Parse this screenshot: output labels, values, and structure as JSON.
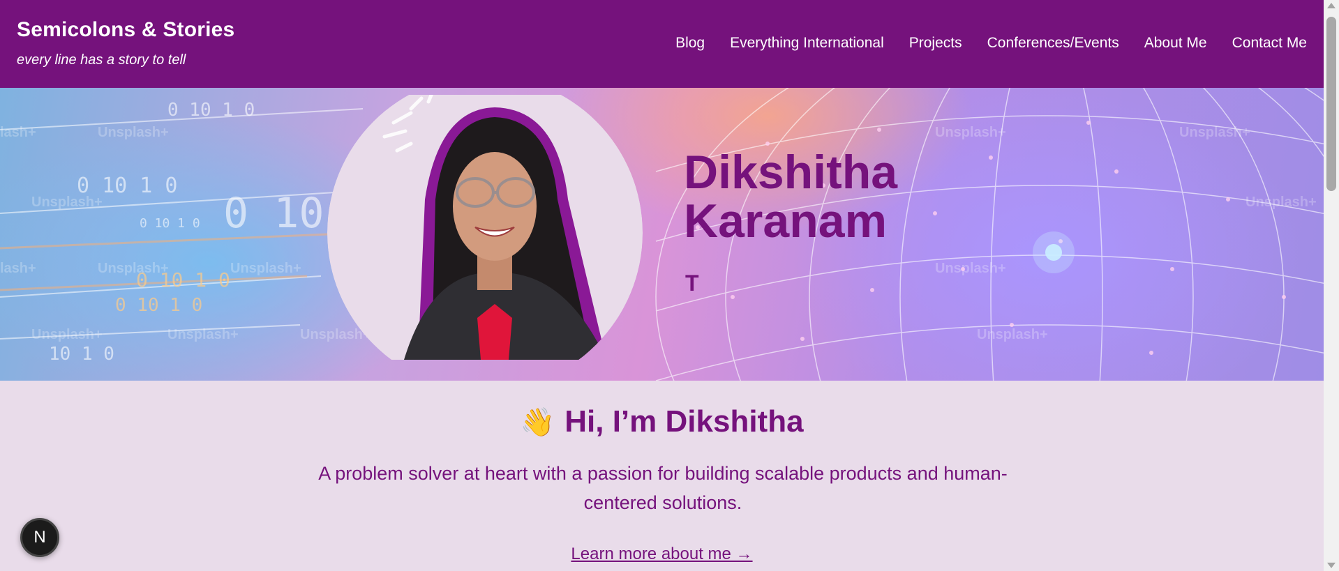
{
  "header": {
    "title": "Semicolons & Stories",
    "tagline": "every line has a story to tell",
    "nav": [
      "Blog",
      "Everything International",
      "Projects",
      "Conferences/Events",
      "About Me",
      "Contact Me"
    ],
    "color": "#75127c"
  },
  "hero": {
    "name_first": "Dikshitha",
    "name_last": "Karanam",
    "typed_text": "T",
    "watermark": "Unsplash+"
  },
  "intro": {
    "wave_icon": "👋",
    "heading": "Hi, I’m Dikshitha",
    "text": "A problem solver at heart with a passion for building scalable products and human-centered solutions.",
    "link": "Learn more about me →"
  },
  "badge": {
    "label": "N"
  },
  "colors": {
    "accent": "#75127c",
    "background": "#e9dcea"
  }
}
